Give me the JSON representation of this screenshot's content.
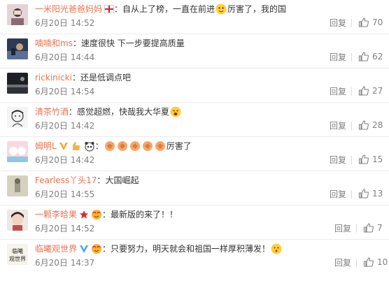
{
  "comments": [
    {
      "user": "一米阳光爸爸妈妈",
      "text": "自从上了榜，一直在前进",
      "text2": "厉害了，我的国",
      "time": "6月20日 14:52",
      "reply": "回复",
      "likes": "70"
    },
    {
      "user": "喃喃和ms",
      "text": "速度很快 下一步要提高质量",
      "time": "6月20日 14:44",
      "reply": "回复",
      "likes": "62"
    },
    {
      "user": "rickinicki",
      "text": "还是低调点吧",
      "time": "6月20日 14:54",
      "reply": "回复",
      "likes": "27"
    },
    {
      "user": "清茶竹酒",
      "text": "感觉超燃，快哉我大华夏",
      "time": "6月20日 14:42",
      "reply": "回复",
      "likes": "28"
    },
    {
      "user": "姆明L",
      "text": "厉害了",
      "time": "6月20日 14:42",
      "reply": "回复",
      "likes": "15"
    },
    {
      "user": "Fearless丫头17",
      "text": "大国崛起",
      "time": "6月20日 14:55",
      "reply": "回复",
      "likes": "13"
    },
    {
      "user": "一颗李晗果",
      "text": "最新版的来了！！",
      "time": "6月20日 14:52",
      "reply": "回复",
      "likes": "7"
    },
    {
      "user": "临曦观世界",
      "text": "只要努力，明天就会和祖国一样厚积薄发！",
      "time": "6月20日 14:37",
      "reply": "回复",
      "likes": "10"
    }
  ],
  "avatar_texts": {
    "c7": "临曦观世界"
  },
  "colors": {
    "username": "#eb7350",
    "meta": "#808080",
    "text": "#333333"
  }
}
